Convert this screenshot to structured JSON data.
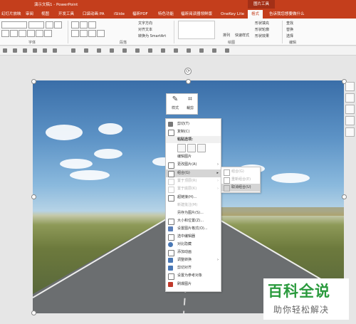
{
  "window": {
    "title": "演示文稿1 - PowerPoint",
    "picture_tools": "图片工具"
  },
  "tabs": [
    "幻灯片放映",
    "审阅",
    "视图",
    "开发工具",
    "口袋动画 PA",
    "iSlide",
    "福昕PDF",
    "特色功能",
    "福昕阅读器领鲜版",
    "OneKey Lite",
    "格式",
    "告诉我您想要做什么"
  ],
  "ribbon": {
    "group_font": "字体",
    "group_paragraph": "段落",
    "group_drawing": "绘图",
    "group_edit": "编辑",
    "text_direction": "文字方向",
    "align_text": "对齐文本",
    "convert_smartart": "转换为 SmartArt",
    "arrange": "排列",
    "quick_styles": "快速样式",
    "shape_fill": "形状填充",
    "shape_outline": "形状轮廓",
    "shape_effects": "形状效果",
    "find": "查找",
    "replace": "替换",
    "select": "选择"
  },
  "mini_toolbar": {
    "style": "样式",
    "crop": "裁剪"
  },
  "context_menu": {
    "cut": "剪切(T)",
    "copy": "复制(C)",
    "paste_options": "粘贴选项:",
    "edit_picture": "编辑图片",
    "change_picture": "更改图片(A)",
    "group": "组合(G)",
    "bring_front": "置于顶层(R)",
    "send_back": "置于底层(K)",
    "hyperlink": "超链接(H)...",
    "new_comment": "新建批注(M)",
    "save_as_picture": "另存为图片(S)...",
    "size_position": "大小和位置(Z)...",
    "format_picture": "设置图片格式(O)...",
    "selection_pane": "选中编辑器",
    "compress": "对比隐藏",
    "add_animation": "添加动画",
    "adjust_convert": "调整转换",
    "cut_fill": "剪切对齐",
    "set_as_target": "设置为参考对象",
    "flash_picture": "刷爆图片"
  },
  "submenu": {
    "group": "组合(G)",
    "regroup": "重新组合(E)",
    "ungroup": "取消组合(U)"
  },
  "watermark": {
    "title": "百科全说",
    "subtitle": "助你轻松解决"
  },
  "colors": {
    "accent": "#c43e1c",
    "watermark_green": "#2a9a3d",
    "menu_highlight": "#d5d5d5"
  }
}
